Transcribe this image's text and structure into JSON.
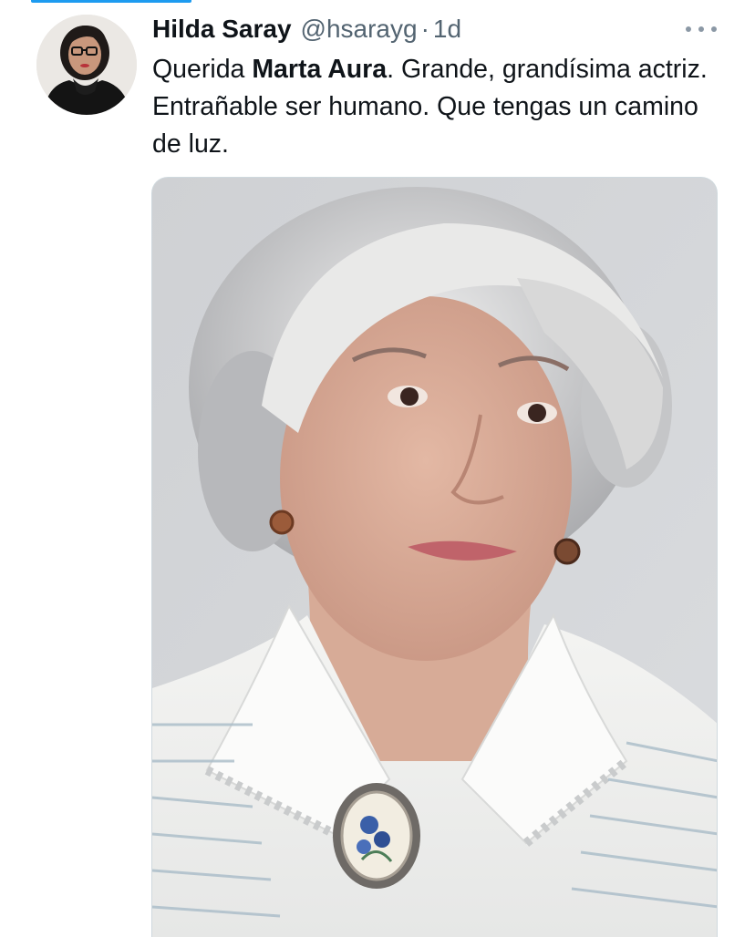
{
  "tweet": {
    "display_name": "Hilda Saray",
    "handle": "@hsarayg",
    "separator": "·",
    "time": "1d",
    "text_before": "Querida ",
    "mention_bold": "Marta Aura",
    "text_after": ". Grande, grandísima actriz. Entrañable ser humano. Que tengas un camino de luz."
  },
  "icons": {
    "more": "more-options-icon"
  },
  "colors": {
    "accent": "#1d9bf0",
    "text": "#0f1419",
    "secondary_text": "#536471"
  }
}
